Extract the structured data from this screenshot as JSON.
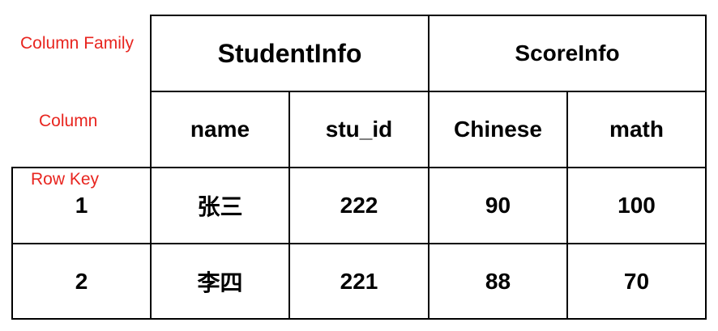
{
  "labels": {
    "column_family": "Column Family",
    "column": "Column",
    "row_key": "Row Key"
  },
  "table": {
    "column_families": [
      "StudentInfo",
      "ScoreInfo"
    ],
    "columns": [
      "name",
      "stu_id",
      "Chinese",
      "math"
    ],
    "rows": [
      {
        "key": "1",
        "name": "张三",
        "stu_id": "222",
        "chinese": "90",
        "math": "100"
      },
      {
        "key": "2",
        "name": "李四",
        "stu_id": "221",
        "chinese": "88",
        "math": "70"
      }
    ]
  },
  "colors": {
    "label": "#e8251f",
    "border": "#000000",
    "text": "#000000"
  }
}
